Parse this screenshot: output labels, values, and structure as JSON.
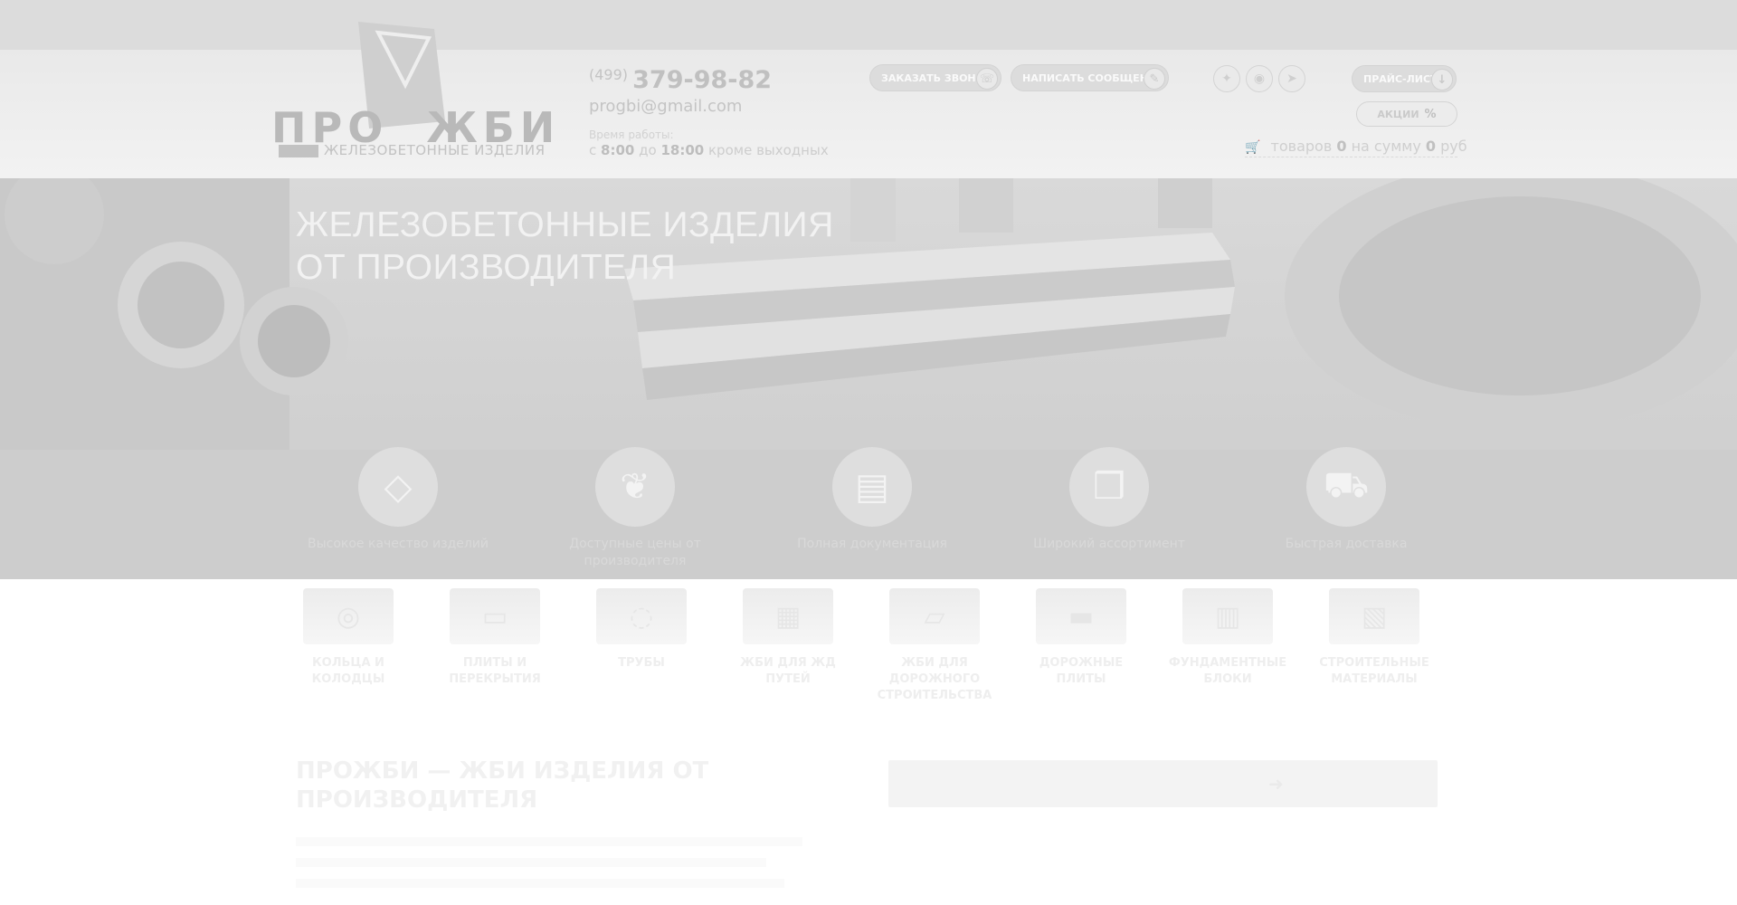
{
  "header": {
    "logo": {
      "word_left": "ПРО",
      "word_right": "ЖБИ",
      "tagline": "ЖЕЛЕЗОБЕТОННЫЕ ИЗДЕЛИЯ"
    },
    "phone_code": "(499)",
    "phone_number": "379-98-82",
    "email": "progbi@gmail.com",
    "hours_label": "Время работы:",
    "hours_from_prefix": "с",
    "hours_from": "8:00",
    "hours_to_prefix": "до",
    "hours_to": "18:00",
    "hours_suffix": "кроме выходных",
    "call_button": "Заказать звонок",
    "message_button": "Написать сообщение",
    "price_button": "Прайс-лист",
    "promo_button": "Акции",
    "promo_symbol": "%",
    "cart": {
      "label_items": "товаров",
      "items": "0",
      "label_sum": "на сумму",
      "sum": "0",
      "currency": "руб"
    },
    "socials": [
      "vk-icon",
      "ok-icon",
      "telegram-icon"
    ]
  },
  "hero": {
    "title": "ЖЕЛЕЗОБЕТОННЫЕ ИЗДЕЛИЯ ОТ ПРОИЗВОДИТЕЛЯ",
    "features": [
      {
        "icon": "diamond-icon",
        "label": "Высокое качество изделий"
      },
      {
        "icon": "hands-money-icon",
        "label": "Доступные цены от производителя"
      },
      {
        "icon": "documents-icon",
        "label": "Полная документация"
      },
      {
        "icon": "box-icon",
        "label": "Широкий ассортимент"
      },
      {
        "icon": "truck-icon",
        "label": "Быстрая доставка"
      }
    ]
  },
  "categories": [
    {
      "icon": "rings-icon",
      "label": "Кольца и колодцы"
    },
    {
      "icon": "slabs-icon",
      "label": "Плиты и перекрытия"
    },
    {
      "icon": "pipes-icon",
      "label": "Трубы"
    },
    {
      "icon": "blocks-icon",
      "label": "ЖБИ для ЖД путей"
    },
    {
      "icon": "road-icon",
      "label": "ЖБИ для дорожного строительства"
    },
    {
      "icon": "curb-icon",
      "label": "Дорожные плиты"
    },
    {
      "icon": "foundation-icon",
      "label": "Фундаментные блоки"
    },
    {
      "icon": "materials-icon",
      "label": "Строительные материалы"
    }
  ],
  "about": {
    "title": "ПРОЖБИ — ЖБИ ИЗДЕЛИЯ ОТ ПРОИЗВОДИТЕЛЯ"
  },
  "colors": {
    "top_strip": "#dcdcdc",
    "header_bg": "#eeeeee",
    "hero_bg": "#cfcfcf"
  }
}
